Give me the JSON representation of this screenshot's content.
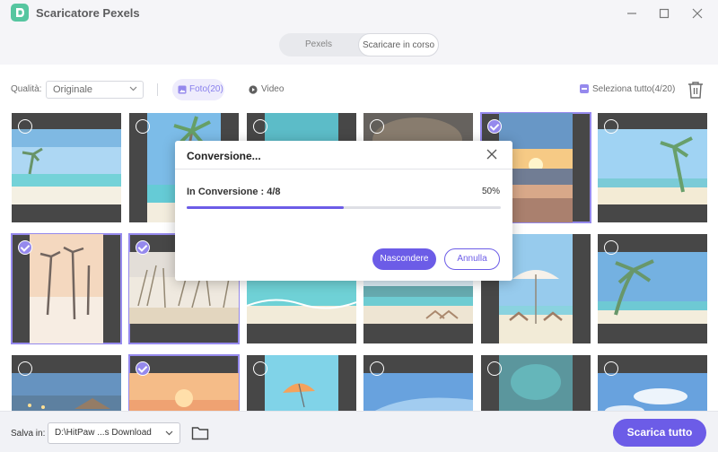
{
  "app": {
    "title": "Scaricatore Pexels"
  },
  "tabs": [
    {
      "label": "Pexels",
      "active": false
    },
    {
      "label": "Scaricare in corso",
      "active": true
    }
  ],
  "toolbar": {
    "quality_label": "Qualità:",
    "quality_value": "Originale",
    "photo_filter": "Foto(20)",
    "video_filter": "Video",
    "select_all": "Seleziona tutto(4/20)"
  },
  "dialog": {
    "title": "Conversione...",
    "status": "In Conversione : 4/8",
    "percent_label": "50%",
    "progress": 0.5,
    "hide_button": "Nascondere",
    "cancel_button": "Annulla"
  },
  "footer": {
    "save_label": "Salva in:",
    "save_path": "D:\\HitPaw ...s Download",
    "download_all": "Scarica tutto"
  },
  "colors": {
    "accent": "#6c5ce7",
    "logo": "#16b07c",
    "chrome": "#f1f2f6"
  },
  "thumbnails": [
    {
      "scene": "beach-palm-tropical",
      "selected": false
    },
    {
      "scene": "palm-tree-beach",
      "selected": false
    },
    {
      "scene": "turquoise-sea",
      "selected": false
    },
    {
      "scene": "cave-dark",
      "selected": false
    },
    {
      "scene": "sunset-sea",
      "selected": true
    },
    {
      "scene": "beach-palms-sky",
      "selected": false
    },
    {
      "scene": "pink-palms-sunset",
      "selected": true
    },
    {
      "scene": "dune-grass",
      "selected": true
    },
    {
      "scene": "shallow-beach",
      "selected": false
    },
    {
      "scene": "resort-chairs",
      "selected": false
    },
    {
      "scene": "umbrella-chairs",
      "selected": false
    },
    {
      "scene": "palm-sky",
      "selected": false
    },
    {
      "scene": "overwater-villas",
      "selected": false
    },
    {
      "scene": "orange-sunset",
      "selected": true
    },
    {
      "scene": "orange-umbrella",
      "selected": false
    },
    {
      "scene": "blue-sky",
      "selected": false
    },
    {
      "scene": "aerial-reef",
      "selected": false
    },
    {
      "scene": "blue-sky-clouds",
      "selected": false
    }
  ]
}
